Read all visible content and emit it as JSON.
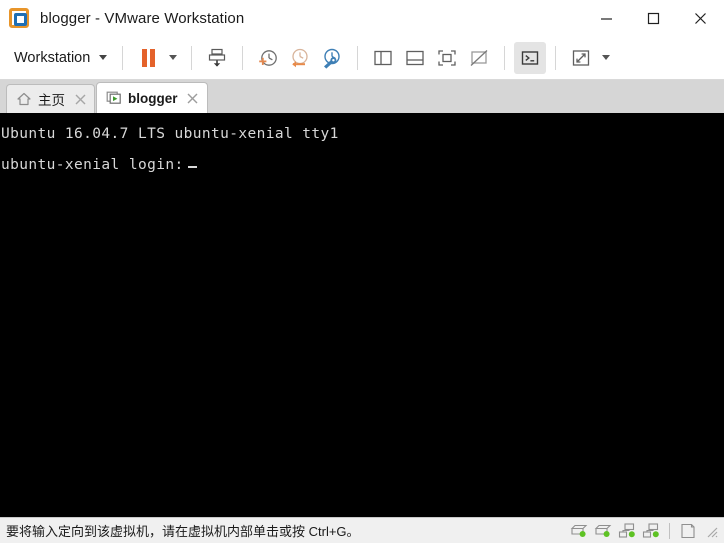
{
  "window": {
    "title": "blogger - VMware Workstation",
    "app_icon": "vmware-logo-icon",
    "controls": {
      "minimize": "minimize-icon",
      "maximize": "maximize-icon",
      "close": "close-icon"
    }
  },
  "toolbar": {
    "workstation_menu": "Workstation",
    "items": [
      {
        "name": "pause-vm-button",
        "icon": "pause-icon"
      },
      {
        "name": "power-dropdown-button",
        "icon": "chevron-down-icon"
      },
      {
        "name": "suspend-vm-button",
        "icon": "suspend-download-icon"
      },
      {
        "name": "take-snapshot-button",
        "icon": "snapshot-add-icon"
      },
      {
        "name": "revert-snapshot-button",
        "icon": "snapshot-revert-icon"
      },
      {
        "name": "snapshot-manager-button",
        "icon": "snapshot-manager-icon"
      },
      {
        "name": "show-library-button",
        "icon": "panel-left-icon"
      },
      {
        "name": "show-thumbnail-bar-button",
        "icon": "panel-bottom-icon"
      },
      {
        "name": "enter-fullscreen-button",
        "icon": "fullscreen-icon"
      },
      {
        "name": "unity-mode-button",
        "icon": "unity-disabled-icon"
      },
      {
        "name": "console-view-button",
        "icon": "console-prompt-icon"
      },
      {
        "name": "stretch-view-button",
        "icon": "stretch-arrows-icon"
      },
      {
        "name": "view-dropdown-button",
        "icon": "chevron-down-icon"
      }
    ]
  },
  "tabs": [
    {
      "label": "主页",
      "icon": "home-icon",
      "active": false,
      "close": "close-icon"
    },
    {
      "label": "blogger",
      "icon": "vm-running-icon",
      "active": true,
      "close": "close-icon"
    }
  ],
  "vm_console": {
    "lines": [
      "Ubuntu 16.04.7 LTS ubuntu-xenial tty1",
      "ubuntu-xenial login:"
    ],
    "cursor_visible": true,
    "background": "#000000",
    "foreground": "#d8d8d8"
  },
  "statusbar": {
    "message": "要将输入定向到该虚拟机，请在虚拟机内部单击或按 Ctrl+G。",
    "devices": [
      {
        "name": "hard-disk-1-status-icon",
        "icon": "hard-disk-icon",
        "active": true
      },
      {
        "name": "hard-disk-2-status-icon",
        "icon": "hard-disk-icon",
        "active": true
      },
      {
        "name": "network-adapter-1-status-icon",
        "icon": "network-adapter-icon",
        "active": true
      },
      {
        "name": "network-adapter-2-status-icon",
        "icon": "network-adapter-icon",
        "active": true
      },
      {
        "name": "removable-device-status-icon",
        "icon": "document-icon",
        "active": false
      }
    ],
    "resize_grip": "resize-grip-icon"
  },
  "colors": {
    "accent_orange": "#e4622b",
    "accent_blue": "#1f6fb4",
    "status_green": "#57c417",
    "tabbar_bg": "#d6d6d6",
    "statusbar_bg": "#f0f0f0"
  }
}
